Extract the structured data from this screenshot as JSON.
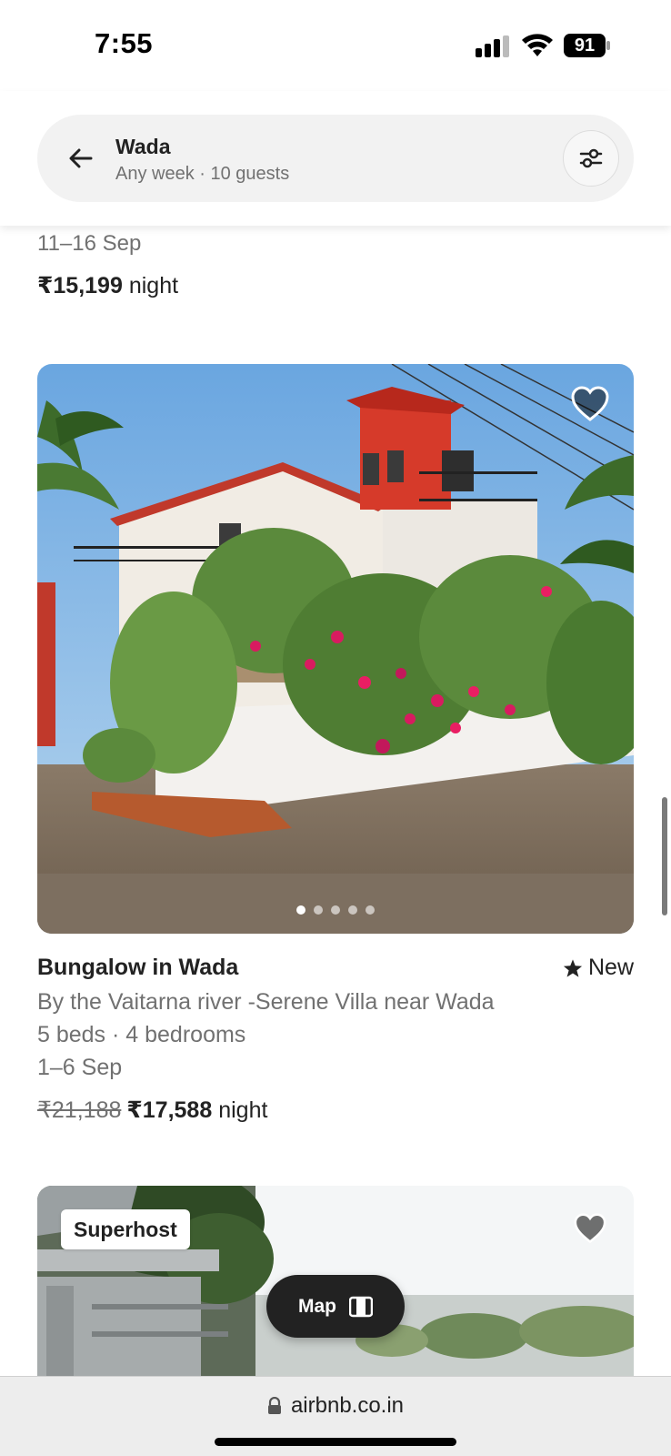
{
  "status_bar": {
    "time": "7:55",
    "battery": "91"
  },
  "search": {
    "location": "Wada",
    "details": "Any week · 10 guests"
  },
  "previous_listing": {
    "dates": "11–16 Sep",
    "price": "₹15,199",
    "price_unit": "night"
  },
  "listing": {
    "title": "Bungalow in Wada",
    "rating_label": "New",
    "description": "By the Vaitarna river -Serene Villa near Wada",
    "beds": "5 beds · 4 bedrooms",
    "dates": "1–6 Sep",
    "original_price": "₹21,188",
    "price": "₹17,588",
    "price_unit": "night",
    "photo_count": 5,
    "active_photo": 1
  },
  "next_listing": {
    "badge": "Superhost"
  },
  "map_button": {
    "label": "Map"
  },
  "browser": {
    "url": "airbnb.co.in"
  },
  "icons": [
    "back-arrow-icon",
    "filter-icon",
    "heart-icon",
    "star-icon",
    "map-icon",
    "lock-icon"
  ]
}
